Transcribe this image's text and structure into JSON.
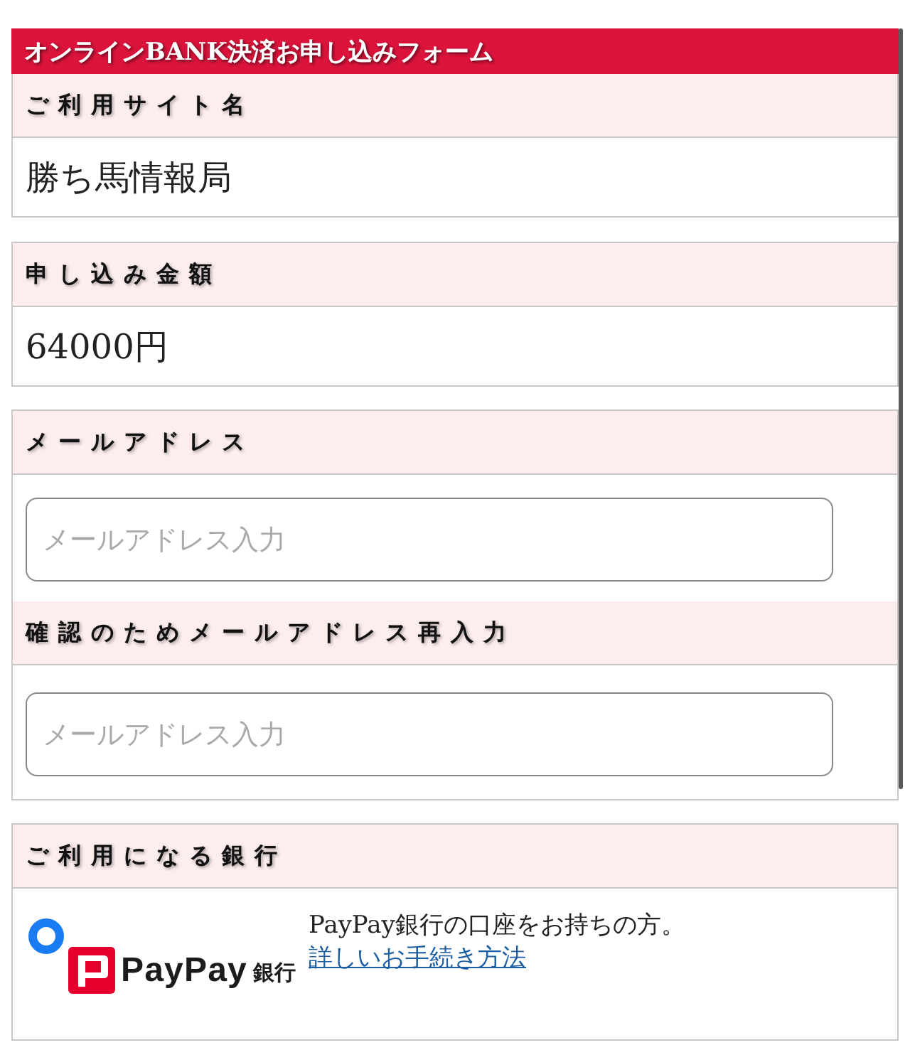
{
  "form": {
    "title": "オンラインBANK決済お申し込みフォーム",
    "sections": [
      {
        "fields": [
          {
            "kind": "text",
            "label": "ご利用サイト名",
            "value": "勝ち馬情報局"
          }
        ]
      },
      {
        "fields": [
          {
            "kind": "text",
            "label": "申し込み金額",
            "value": "64000円"
          }
        ]
      },
      {
        "fields": [
          {
            "kind": "input",
            "label": "メールアドレス",
            "placeholder": "メールアドレス入力"
          },
          {
            "kind": "input",
            "label": "確認のためメールアドレス再入力",
            "placeholder": "メールアドレス入力"
          }
        ]
      },
      {
        "fields": [
          {
            "kind": "bank_choice",
            "label": "ご利用になる銀行",
            "options": [
              {
                "selected": true,
                "logo": {
                  "wordmark": "PayPay",
                  "suffix": "銀行"
                },
                "description": "PayPay銀行の口座をお持ちの方。",
                "link": "詳しいお手続き方法"
              }
            ]
          }
        ]
      }
    ]
  }
}
